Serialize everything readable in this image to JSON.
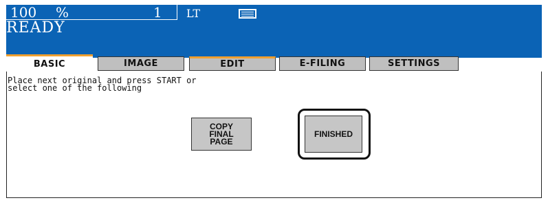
{
  "status": {
    "zoom_value": "100",
    "zoom_unit": "%",
    "copies": "1",
    "paper_size": "LT",
    "paper_icon": "paper-tray-icon",
    "machine_status": "READY"
  },
  "tabs": [
    {
      "label": "BASIC",
      "active": true
    },
    {
      "label": "IMAGE",
      "active": false
    },
    {
      "label": "EDIT",
      "active": false
    },
    {
      "label": "E-FILING",
      "active": false
    },
    {
      "label": "SETTINGS",
      "active": false
    }
  ],
  "main": {
    "message": "Place next original and press START or\nselect one of the following",
    "buttons": {
      "copy_final_page": "COPY\nFINAL\nPAGE",
      "finished": "FINISHED"
    }
  },
  "colors": {
    "header_bg": "#0b63b5",
    "tab_accent": "#f0a030",
    "button_bg": "#c6c6c6"
  }
}
